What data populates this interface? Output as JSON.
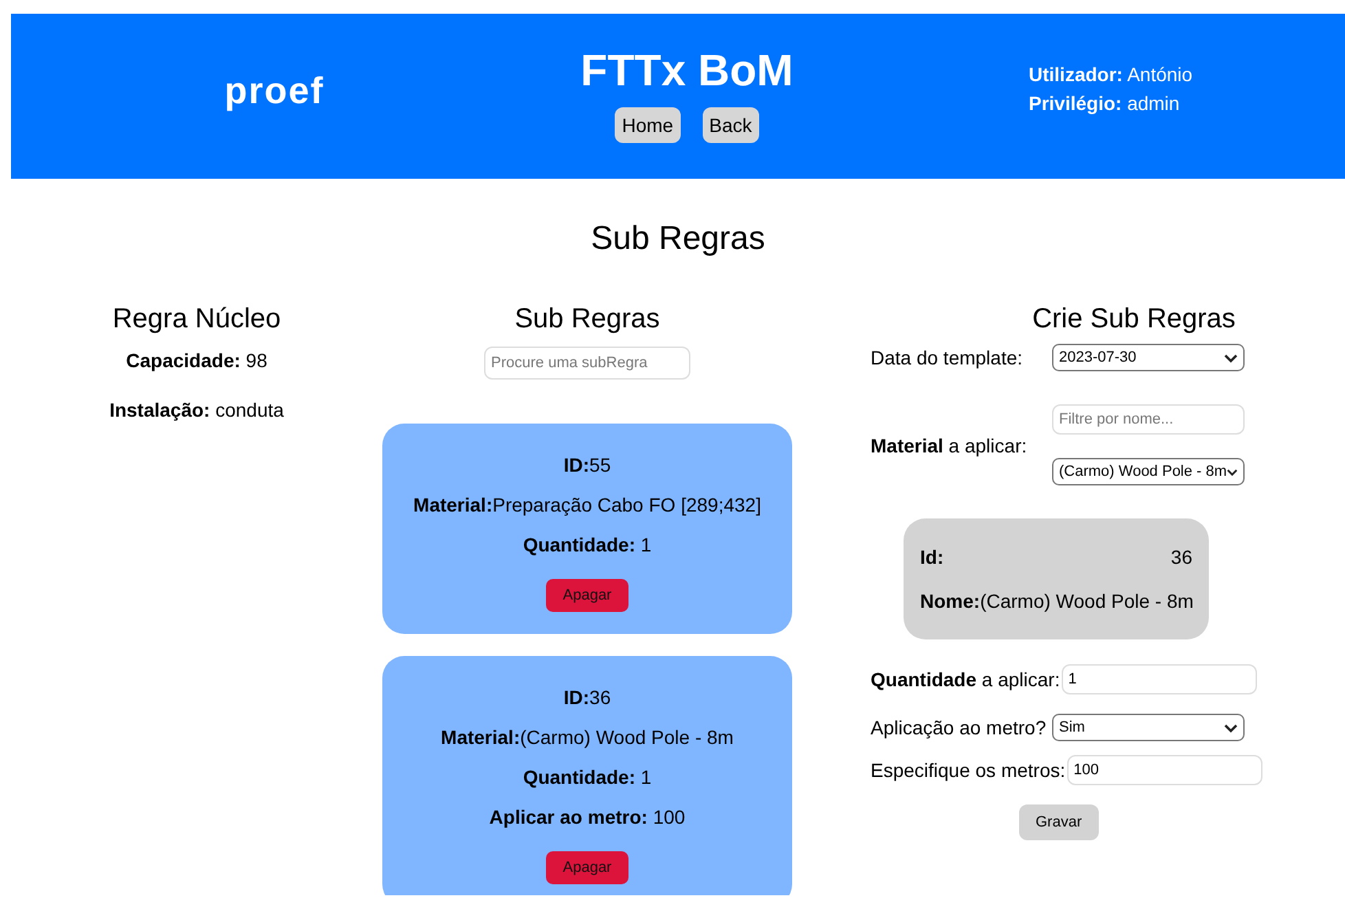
{
  "header": {
    "logo": "proef",
    "title": "FTTx BoM",
    "nav": [
      "Home",
      "Back"
    ],
    "user": [
      {
        "label": "Utilizador:",
        "value": "António"
      },
      {
        "label": "Privilégio:",
        "value": "admin"
      }
    ]
  },
  "page_title": "Sub Regras",
  "core_rule": {
    "title": "Regra Núcleo",
    "lines": [
      "**Capacidade:** 98",
      "**Instalação:** conduta"
    ]
  },
  "sub_rules": {
    "title": "Sub Regras",
    "search_placeholder": "Procure uma subRegra",
    "cards": [
      {
        "lines": [
          "**ID:**55",
          "**Material:**Preparação Cabo FO [289;432]",
          "**Quantidade:** 1"
        ],
        "button": "Apagar"
      },
      {
        "lines": [
          "**ID:**36",
          "**Material:**(Carmo) Wood Pole - 8m",
          "**Quantidade:** 1",
          "**Aplicar ao metro:** 100"
        ],
        "button": "Apagar"
      }
    ]
  },
  "create": {
    "title": "Crie Sub Regras",
    "rows": [
      {
        "kind": "select",
        "label": "Data do template:",
        "value": "2023-07-30"
      },
      {
        "kind": "filter-select",
        "label": "**Material** a aplicar:",
        "placeholder": "Filtre por nome...",
        "value": "(Carmo) Wood Pole - 8m"
      },
      {
        "kind": "preview",
        "id_label": "Id:",
        "id": "36",
        "name": "**Nome:**(Carmo) Wood Pole - 8m"
      },
      {
        "kind": "input",
        "label": "**Quantidade** a aplicar:",
        "value": "1"
      },
      {
        "kind": "select",
        "label": "Aplicação ao metro?",
        "value": "Sim"
      },
      {
        "kind": "input",
        "label": "Especifique os metros:",
        "value": "100"
      }
    ],
    "button": "Gravar"
  }
}
